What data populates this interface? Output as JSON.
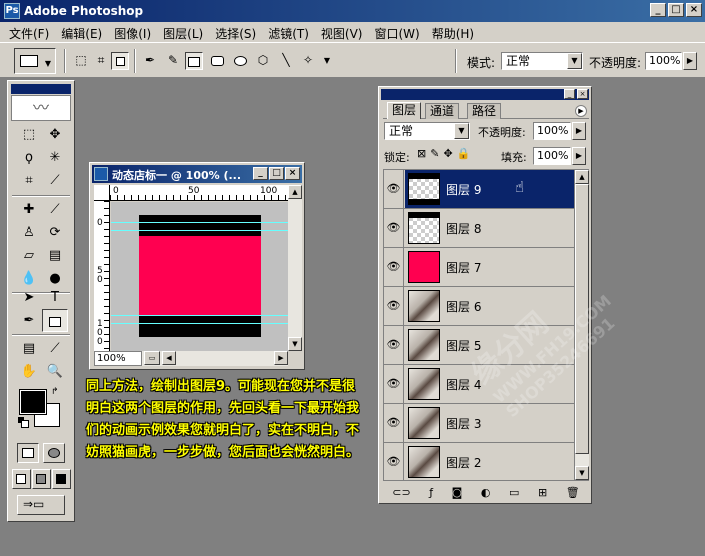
{
  "window": {
    "title": "Adobe Photoshop",
    "app_icon": "photoshop-icon",
    "controls": [
      "_",
      "□",
      "×"
    ]
  },
  "menu": [
    "文件(F)",
    "编辑(E)",
    "图像(I)",
    "图层(L)",
    "选择(S)",
    "滤镜(T)",
    "视图(V)",
    "窗口(W)",
    "帮助(H)"
  ],
  "options_bar": {
    "mode_label": "模式:",
    "mode_value": "正常",
    "opacity_label": "不透明度:",
    "opacity_value": "100%"
  },
  "document": {
    "title": "动态店标一 @ 100% (...",
    "zoom": "100%",
    "ruler_h": [
      "0",
      "50",
      "100"
    ],
    "ruler_v": [
      "0",
      "5\n0",
      "1\n0\n0"
    ],
    "colors": {
      "black": "#000000",
      "pink": "#ff0050",
      "guide": "#66ffff"
    }
  },
  "instruction": "同上方法，绘制出图层9。可能现在您并不是很明白这两个图层的作用，先回头看一下最开始我们的动画示例效果您就明白了，实在不明白，不妨照猫画虎，一步步做，您后面也会恍然明白。",
  "layers_panel": {
    "tabs": [
      "图层",
      "通道",
      "路径"
    ],
    "blend_mode": "正常",
    "opacity_label": "不透明度:",
    "opacity_value": "100%",
    "lock_label": "锁定:",
    "fill_label": "填充:",
    "fill_value": "100%",
    "layers": [
      {
        "name": "图层 9",
        "thumb": "checker-bars",
        "selected": true
      },
      {
        "name": "图层 8",
        "thumb": "checker-bar-top"
      },
      {
        "name": "图层 7",
        "thumb": "pink"
      },
      {
        "name": "图层 6",
        "thumb": "photo"
      },
      {
        "name": "图层 5",
        "thumb": "photo"
      },
      {
        "name": "图层 4",
        "thumb": "photo"
      },
      {
        "name": "图层 3",
        "thumb": "photo"
      },
      {
        "name": "图层 2",
        "thumb": "photo"
      }
    ],
    "bottom_icons": [
      "link-icon",
      "style-icon",
      "mask-icon",
      "adjustment-icon",
      "folder-icon",
      "new-layer-icon",
      "trash-icon"
    ]
  },
  "watermark": {
    "line1": "缘分网",
    "line2": "WWW.FH19.COM",
    "line3": "SHOP35246691"
  }
}
